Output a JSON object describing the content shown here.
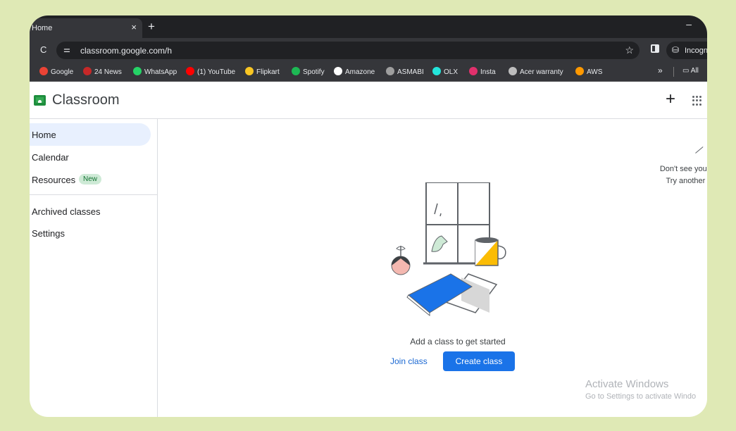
{
  "browser": {
    "tab_title": "Home",
    "tab_close": "×",
    "new_tab": "+",
    "minimize": "–",
    "reload": "C",
    "url": "classroom.google.com/h",
    "star": "☆",
    "profile_label": "Incogn"
  },
  "bookmarks": [
    {
      "label": "Google",
      "color": "#ea4335"
    },
    {
      "label": "24 News",
      "color": "#c62828"
    },
    {
      "label": "WhatsApp",
      "color": "#25d366"
    },
    {
      "label": "(1) YouTube",
      "color": "#ff0000"
    },
    {
      "label": "Flipkart",
      "color": "#f9c623"
    },
    {
      "label": "Spotify",
      "color": "#1db954"
    },
    {
      "label": "Amazone",
      "color": "#ffffff"
    },
    {
      "label": "ASMABI",
      "color": "#9e9e9e"
    },
    {
      "label": "OLX",
      "color": "#23e5db"
    },
    {
      "label": "Insta",
      "color": "#e1306c"
    },
    {
      "label": "Acer warranty",
      "color": "#bdbdbd"
    },
    {
      "label": "AWS",
      "color": "#ff9900"
    }
  ],
  "bookmarks_more": "»",
  "bookmarks_all": "All",
  "app": {
    "title": "Classroom",
    "add": "+"
  },
  "sidebar": {
    "items": [
      {
        "label": "Home"
      },
      {
        "label": "Calendar"
      },
      {
        "label": "Resources",
        "badge": "New"
      },
      {
        "label": "Archived classes"
      },
      {
        "label": "Settings"
      }
    ]
  },
  "main": {
    "prompt": "Add a class to get started",
    "join_label": "Join class",
    "create_label": "Create class",
    "account_line1": "Don't see your c",
    "account_line2": "Try another ac"
  },
  "watermark": {
    "line1": "Activate Windows",
    "line2": "Go to Settings to activate Windo"
  },
  "colors": {
    "accent": "#1a73e8",
    "nav_active": "#e8f0fe",
    "badge_bg": "#ceead6",
    "mug_yellow": "#fbbc04",
    "book_blue": "#1a73e8"
  }
}
